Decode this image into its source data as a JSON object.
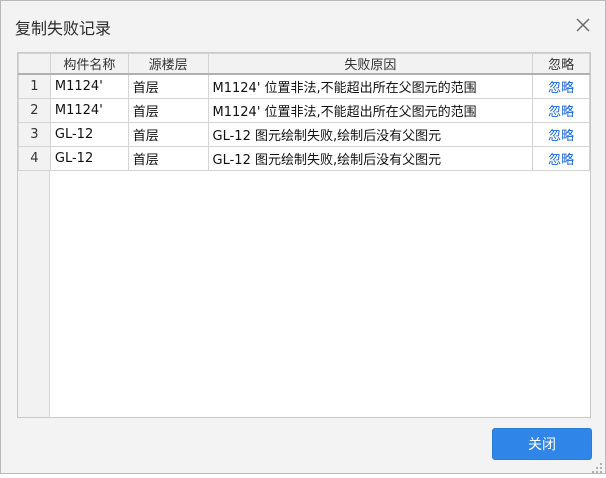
{
  "dialog": {
    "title": "复制失败记录",
    "close_icon": "close-icon",
    "close_button_label": "关闭"
  },
  "table": {
    "columns": [
      "",
      "构件名称",
      "源楼层",
      "失败原因",
      "忽略"
    ],
    "rows": [
      {
        "num": "1",
        "name": "M1124'",
        "floor": "首层",
        "reason": "M1124' 位置非法,不能超出所在父图元的范围",
        "action": "忽略"
      },
      {
        "num": "2",
        "name": "M1124'",
        "floor": "首层",
        "reason": "M1124' 位置非法,不能超出所在父图元的范围",
        "action": "忽略"
      },
      {
        "num": "3",
        "name": "GL-12",
        "floor": "首层",
        "reason": "GL-12 图元绘制失败,绘制后没有父图元",
        "action": "忽略"
      },
      {
        "num": "4",
        "name": "GL-12",
        "floor": "首层",
        "reason": "GL-12 图元绘制失败,绘制后没有父图元",
        "action": "忽略"
      }
    ]
  },
  "colors": {
    "accent": "#2f86e8",
    "link": "#1a66d0"
  }
}
